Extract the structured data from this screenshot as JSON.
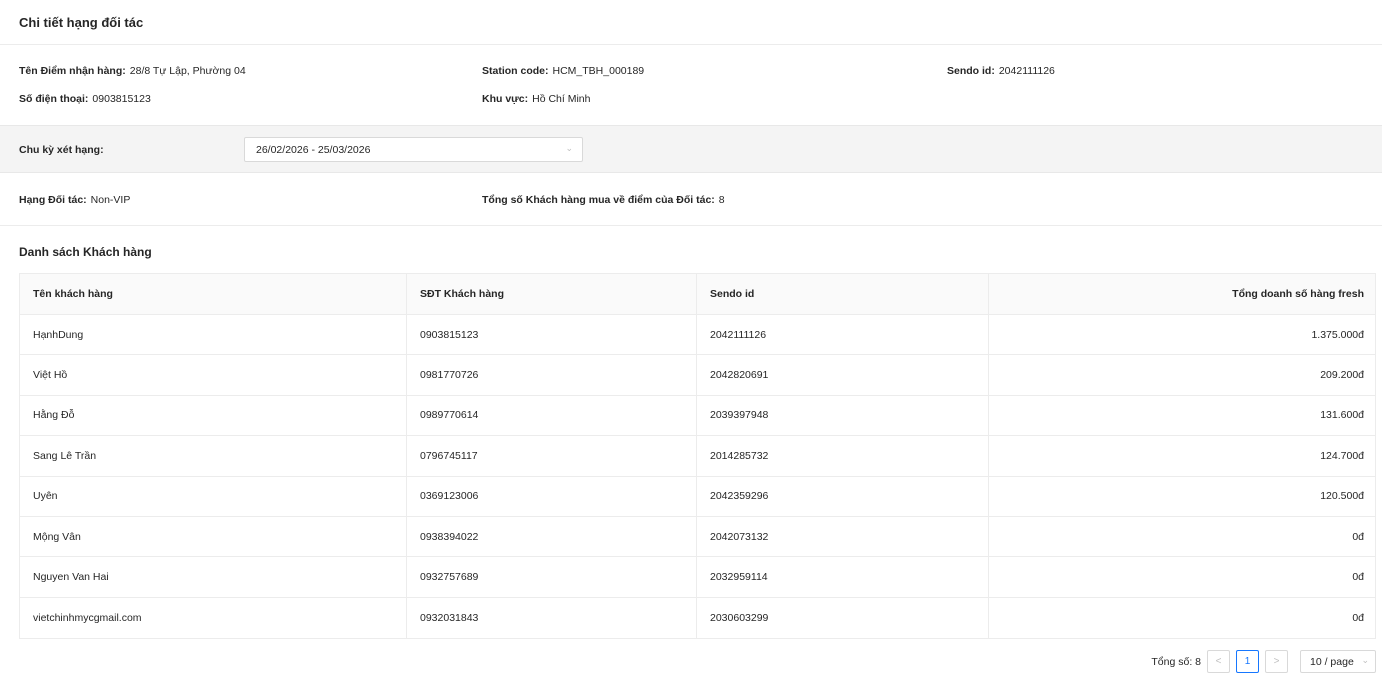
{
  "header": {
    "title": "Chi tiết hạng đối tác"
  },
  "info": {
    "address_label": "Tên Điểm nhận hàng:",
    "address_value": "28/8 Tự Lập, Phường 04",
    "station_label": "Station code:",
    "station_value": "HCM_TBH_000189",
    "sendo_label": "Sendo id:",
    "sendo_value": "2042111126",
    "phone_label": "Số điện thoại:",
    "phone_value": "0903815123",
    "region_label": "Khu vực:",
    "region_value": "Hồ Chí Minh"
  },
  "cycle": {
    "label": "Chu kỳ xét hạng:",
    "value": "26/02/2026 - 25/03/2026"
  },
  "rank": {
    "rank_label": "Hạng Đối tác:",
    "rank_value": "Non-VIP",
    "total_label": "Tổng số Khách hàng mua về điểm của Đối tác:",
    "total_value": "8"
  },
  "customers": {
    "title": "Danh sách Khách hàng",
    "columns": [
      "Tên khách hàng",
      "SĐT Khách hàng",
      "Sendo id",
      "Tổng doanh số hàng fresh"
    ],
    "rows": [
      {
        "name": "HạnhDung",
        "phone": "0903815123",
        "sendo_id": "2042111126",
        "total": "1.375.000đ"
      },
      {
        "name": "Việt Hồ",
        "phone": "0981770726",
        "sendo_id": "2042820691",
        "total": "209.200đ"
      },
      {
        "name": "Hằng Đỗ",
        "phone": "0989770614",
        "sendo_id": "2039397948",
        "total": "131.600đ"
      },
      {
        "name": "Sang Lê Trần",
        "phone": "0796745117",
        "sendo_id": "2014285732",
        "total": "124.700đ"
      },
      {
        "name": "Uyên",
        "phone": "0369123006",
        "sendo_id": "2042359296",
        "total": "120.500đ"
      },
      {
        "name": "Mộng Vân",
        "phone": "0938394022",
        "sendo_id": "2042073132",
        "total": "0đ"
      },
      {
        "name": "Nguyen Van Hai",
        "phone": "0932757689",
        "sendo_id": "2032959114",
        "total": "0đ"
      },
      {
        "name": "vietchinhmycgmail.com",
        "phone": "0932031843",
        "sendo_id": "2030603299",
        "total": "0đ"
      }
    ]
  },
  "pagination": {
    "total_text": "Tổng số: 8",
    "current_page": "1",
    "page_size": "10 / page",
    "prev_icon": "chevron-left-icon",
    "next_icon": "chevron-right-icon"
  },
  "colors": {
    "accent": "#1677ff",
    "section_bg": "#f4f4f4",
    "border": "#ececec"
  }
}
